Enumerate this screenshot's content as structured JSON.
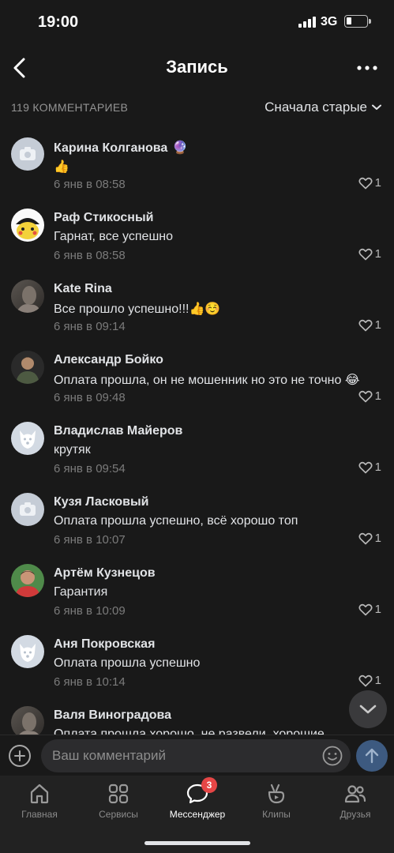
{
  "status_bar": {
    "time": "19:00",
    "network": "3G"
  },
  "header": {
    "title": "Запись"
  },
  "comments_header": {
    "count_label": "119 КОММЕНТАРИЕВ",
    "sort_label": "Сначала старые"
  },
  "comments": [
    {
      "name": "Карина Колганова",
      "name_emoji": "🔮",
      "text": "👍",
      "time": "6 янв в 08:58",
      "likes": "1",
      "avatar": "camera"
    },
    {
      "name": "Раф Стикосный",
      "name_emoji": "",
      "text": "Гарнат, все успешно",
      "time": "6 янв в 08:58",
      "likes": "1",
      "avatar": "pikachu"
    },
    {
      "name": "Kate Rina",
      "name_emoji": "",
      "text": "Все прошло успешно!!!👍☺️",
      "time": "6 янв в 09:14",
      "likes": "1",
      "avatar": "photo-dark"
    },
    {
      "name": "Александр Бойко",
      "name_emoji": "",
      "text": "Оплата прошла, он не мошенник но это не точно 😂",
      "time": "6 янв в 09:48",
      "likes": "1",
      "avatar": "photo-man"
    },
    {
      "name": "Владислав Майеров",
      "name_emoji": "",
      "text": "крутяк",
      "time": "6 янв в 09:54",
      "likes": "1",
      "avatar": "dog"
    },
    {
      "name": "Кузя Ласковый",
      "name_emoji": "",
      "text": "Оплата прошла успешно, всё хорошо топ",
      "time": "6 янв в 10:07",
      "likes": "1",
      "avatar": "camera"
    },
    {
      "name": "Артём Кузнецов",
      "name_emoji": "",
      "text": "Гарантия",
      "time": "6 янв в 10:09",
      "likes": "1",
      "avatar": "photo-red"
    },
    {
      "name": "Аня Покровская",
      "name_emoji": "",
      "text": "Оплата прошла успешно",
      "time": "6 янв в 10:14",
      "likes": "1",
      "avatar": "dog"
    },
    {
      "name": "Валя Виноградова",
      "name_emoji": "",
      "text": "Оплата прошла хорошо, не развели, хорошие",
      "time": "",
      "likes": "",
      "avatar": "photo-dark"
    }
  ],
  "composer": {
    "placeholder": "Ваш комментарий"
  },
  "tabs": [
    {
      "label": "Главная",
      "icon": "home-icon",
      "active": false
    },
    {
      "label": "Сервисы",
      "icon": "services-icon",
      "active": false
    },
    {
      "label": "Мессенджер",
      "icon": "messenger-icon",
      "active": true,
      "badge": "3"
    },
    {
      "label": "Клипы",
      "icon": "clips-icon",
      "active": false
    },
    {
      "label": "Друзья",
      "icon": "friends-icon",
      "active": false
    }
  ],
  "colors": {
    "background": "#191919",
    "tabbar": "#222222",
    "badge": "#e64646",
    "send": "#3d5a80"
  }
}
